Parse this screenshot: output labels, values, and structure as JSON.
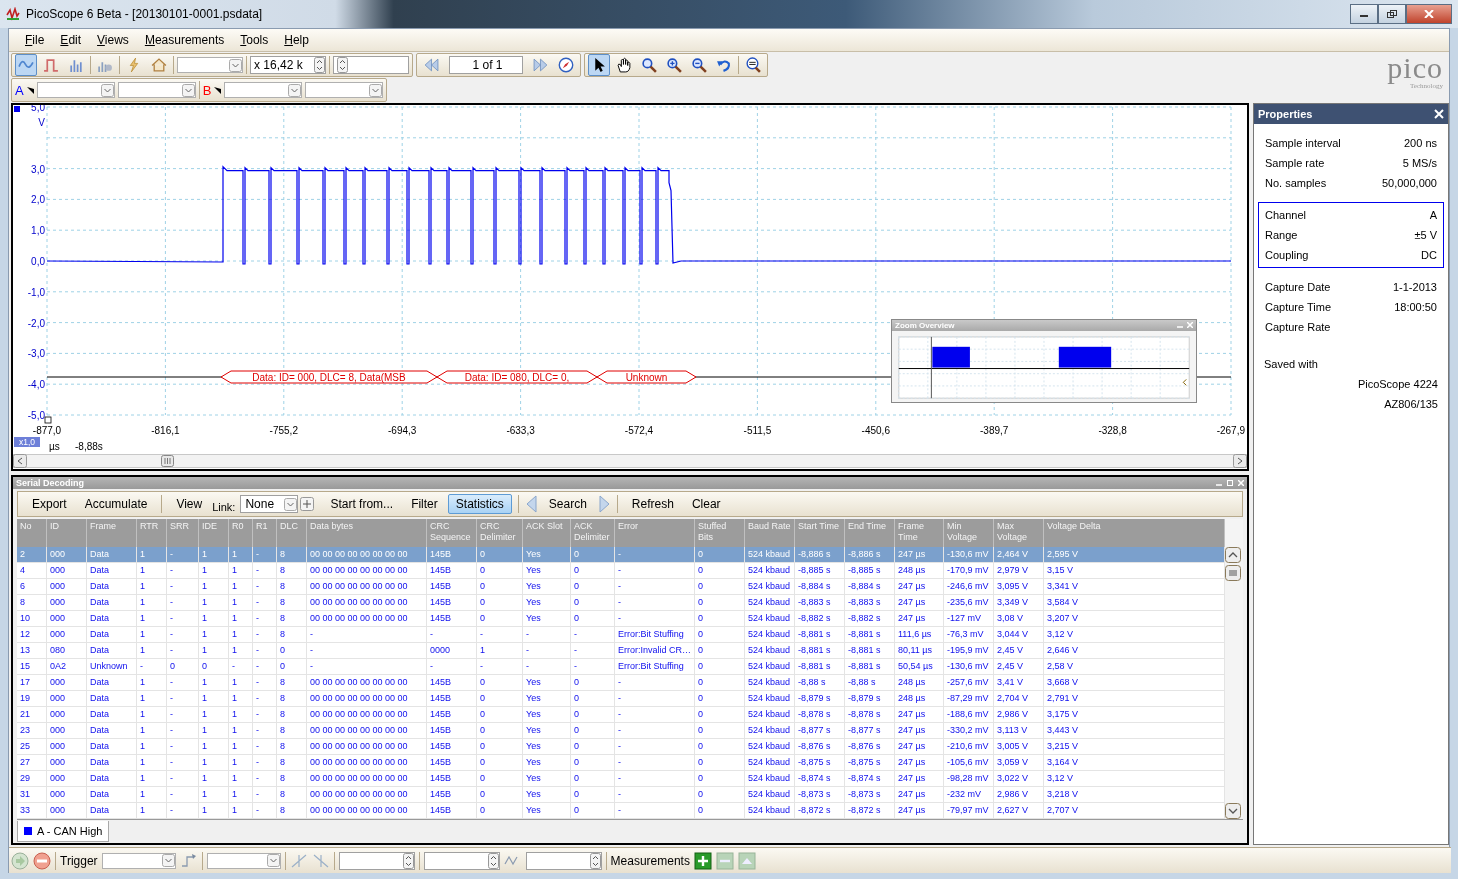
{
  "window": {
    "title": "PicoScope 6 Beta - [20130101-0001.psdata]"
  },
  "menu": [
    "File",
    "Edit",
    "Views",
    "Measurements",
    "Tools",
    "Help"
  ],
  "toolbar": {
    "modes": [
      {
        "kind": "scope",
        "selected": true
      },
      {
        "kind": "persistence",
        "selected": false
      },
      {
        "kind": "spectrum",
        "selected": false
      }
    ],
    "zoom_factor": "x 16,42 k",
    "buffer": "1  of 1",
    "tools": [
      {
        "kind": "pointer",
        "selected": true
      },
      {
        "kind": "hand",
        "selected": false
      },
      {
        "kind": "zoom",
        "selected": false
      },
      {
        "kind": "zoom-in",
        "selected": false
      },
      {
        "kind": "zoom-out",
        "selected": false
      },
      {
        "kind": "undo",
        "selected": false
      },
      {
        "kind": "zoom-100",
        "selected": false
      }
    ]
  },
  "channels": [
    {
      "label": "A",
      "color": "#0000ff"
    },
    {
      "label": "B",
      "color": "#ff0000"
    }
  ],
  "logo": {
    "name": "pico",
    "tagline": "Technology"
  },
  "scope": {
    "y_unit": "V",
    "y_labels": [
      "5,0",
      "3,0",
      "2,0",
      "1,0",
      "0,0",
      "-1,0",
      "-2,0",
      "-3,0",
      "-4,0",
      "-5,0"
    ],
    "x_labels": [
      "-877,0",
      "-816,1",
      "-755,2",
      "-694,3",
      "-633,3",
      "-572,4",
      "-511,5",
      "-450,6",
      "-389,7",
      "-328,8",
      "-267,9"
    ],
    "x_unit": "µs",
    "zoom_badge": "x1,0",
    "time_offset": "-8,88s",
    "decodes": [
      {
        "text": "Data: ID= 000, DLC= 8, Data(MSB"
      },
      {
        "text": "Data: ID= 080, DLC= 0,"
      },
      {
        "text": "Unknown"
      }
    ],
    "zoom_overview": {
      "title": "Zoom Overview"
    }
  },
  "properties": {
    "title": "Properties",
    "groups": [
      {
        "boxed": false,
        "rows": [
          {
            "label": "Sample interval",
            "value": "200 ns"
          },
          {
            "label": "Sample rate",
            "value": "5 MS/s"
          },
          {
            "label": "No. samples",
            "value": "50,000,000"
          }
        ]
      },
      {
        "boxed": true,
        "rows": [
          {
            "label": "Channel",
            "value": "A"
          },
          {
            "label": "Range",
            "value": "±5 V"
          },
          {
            "label": "Coupling",
            "value": "DC"
          }
        ]
      },
      {
        "boxed": false,
        "rows": [
          {
            "label": "Capture Date",
            "value": "1-1-2013"
          },
          {
            "label": "Capture Time",
            "value": "18:00:50"
          },
          {
            "label": "Capture Rate"
          }
        ]
      }
    ],
    "saved_with": {
      "label": "Saved with",
      "values": [
        "PicoScope 4224",
        "AZ806/135"
      ]
    }
  },
  "serial": {
    "title": "Serial Decoding",
    "toolbar": [
      {
        "kind": "button",
        "label": "Export",
        "on": false
      },
      {
        "kind": "button",
        "label": "Accumulate",
        "on": false
      },
      {
        "kind": "separator"
      },
      {
        "kind": "button",
        "label": "View",
        "on": false
      },
      {
        "kind": "link",
        "label": "Link:",
        "value": "None"
      },
      {
        "kind": "button",
        "label": "Start from...",
        "on": false
      },
      {
        "kind": "button",
        "label": "Filter",
        "on": false
      },
      {
        "kind": "button",
        "label": "Statistics",
        "on": true
      },
      {
        "kind": "separator"
      },
      {
        "kind": "prev"
      },
      {
        "kind": "button",
        "label": "Search",
        "on": false
      },
      {
        "kind": "next"
      },
      {
        "kind": "separator"
      },
      {
        "kind": "button",
        "label": "Refresh",
        "on": false
      },
      {
        "kind": "button",
        "label": "Clear",
        "on": false
      }
    ],
    "columns": [
      "No",
      "ID",
      "Frame",
      "RTR",
      "SRR",
      "IDE",
      "R0",
      "R1",
      "DLC",
      "Data bytes",
      "CRC Sequence",
      "CRC Delimiter",
      "ACK Slot",
      "ACK Delimiter",
      "Error",
      "Stuffed Bits",
      "Baud Rate",
      "Start Time",
      "End Time",
      "Frame Time",
      "Min Voltage",
      "Max Voltage",
      "Voltage Delta"
    ],
    "rows": [
      {
        "selected": true,
        "cells": [
          "2",
          "000",
          "Data",
          "1",
          "-",
          "1",
          "1",
          "-",
          "8",
          "00 00 00 00 00 00 00 00",
          "145B",
          "0",
          "Yes",
          "0",
          "-",
          "0",
          "524 kbaud",
          "-8,886 s",
          "-8,886 s",
          "247 µs",
          "-130,6 mV",
          "2,464 V",
          "2,595 V"
        ]
      },
      {
        "selected": false,
        "cells": [
          "4",
          "000",
          "Data",
          "1",
          "-",
          "1",
          "1",
          "-",
          "8",
          "00 00 00 00 00 00 00 00",
          "145B",
          "0",
          "Yes",
          "0",
          "-",
          "0",
          "524 kbaud",
          "-8,885 s",
          "-8,885 s",
          "248 µs",
          "-170,9 mV",
          "2,979 V",
          "3,15 V"
        ]
      },
      {
        "selected": false,
        "cells": [
          "6",
          "000",
          "Data",
          "1",
          "-",
          "1",
          "1",
          "-",
          "8",
          "00 00 00 00 00 00 00 00",
          "145B",
          "0",
          "Yes",
          "0",
          "-",
          "0",
          "524 kbaud",
          "-8,884 s",
          "-8,884 s",
          "247 µs",
          "-246,6 mV",
          "3,095 V",
          "3,341 V"
        ]
      },
      {
        "selected": false,
        "cells": [
          "8",
          "000",
          "Data",
          "1",
          "-",
          "1",
          "1",
          "-",
          "8",
          "00 00 00 00 00 00 00 00",
          "145B",
          "0",
          "Yes",
          "0",
          "-",
          "0",
          "524 kbaud",
          "-8,883 s",
          "-8,883 s",
          "247 µs",
          "-235,6 mV",
          "3,349 V",
          "3,584 V"
        ]
      },
      {
        "selected": false,
        "cells": [
          "10",
          "000",
          "Data",
          "1",
          "-",
          "1",
          "1",
          "-",
          "8",
          "00 00 00 00 00 00 00 00",
          "145B",
          "0",
          "Yes",
          "0",
          "-",
          "0",
          "524 kbaud",
          "-8,882 s",
          "-8,882 s",
          "247 µs",
          "-127 mV",
          "3,08 V",
          "3,207 V"
        ]
      },
      {
        "selected": false,
        "cells": [
          "12",
          "000",
          "Data",
          "1",
          "-",
          "1",
          "1",
          "-",
          "8",
          "-",
          "-",
          "-",
          "-",
          "-",
          "Error:Bit Stuffing",
          "0",
          "524 kbaud",
          "-8,881 s",
          "-8,881 s",
          "111,6 µs",
          "-76,3 mV",
          "3,044 V",
          "3,12 V"
        ]
      },
      {
        "selected": false,
        "cells": [
          "13",
          "080",
          "Data",
          "1",
          "-",
          "1",
          "1",
          "-",
          "0",
          "-",
          "0000",
          "1",
          "-",
          "-",
          "Error:Invalid CR…",
          "0",
          "524 kbaud",
          "-8,881 s",
          "-8,881 s",
          "80,11 µs",
          "-195,9 mV",
          "2,45 V",
          "2,646 V"
        ]
      },
      {
        "selected": false,
        "cells": [
          "15",
          "0A2",
          "Unknown",
          "-",
          "0",
          "0",
          "-",
          "-",
          "0",
          "-",
          "-",
          "-",
          "-",
          "-",
          "Error:Bit Stuffing",
          "0",
          "524 kbaud",
          "-8,881 s",
          "-8,881 s",
          "50,54 µs",
          "-130,6 mV",
          "2,45 V",
          "2,58 V"
        ]
      },
      {
        "selected": false,
        "cells": [
          "17",
          "000",
          "Data",
          "1",
          "-",
          "1",
          "1",
          "-",
          "8",
          "00 00 00 00 00 00 00 00",
          "145B",
          "0",
          "Yes",
          "0",
          "-",
          "0",
          "524 kbaud",
          "-8,88 s",
          "-8,88 s",
          "248 µs",
          "-257,6 mV",
          "3,41 V",
          "3,668 V"
        ]
      },
      {
        "selected": false,
        "cells": [
          "19",
          "000",
          "Data",
          "1",
          "-",
          "1",
          "1",
          "-",
          "8",
          "00 00 00 00 00 00 00 00",
          "145B",
          "0",
          "Yes",
          "0",
          "-",
          "0",
          "524 kbaud",
          "-8,879 s",
          "-8,879 s",
          "248 µs",
          "-87,29 mV",
          "2,704 V",
          "2,791 V"
        ]
      },
      {
        "selected": false,
        "cells": [
          "21",
          "000",
          "Data",
          "1",
          "-",
          "1",
          "1",
          "-",
          "8",
          "00 00 00 00 00 00 00 00",
          "145B",
          "0",
          "Yes",
          "0",
          "-",
          "0",
          "524 kbaud",
          "-8,878 s",
          "-8,878 s",
          "247 µs",
          "-188,6 mV",
          "2,986 V",
          "3,175 V"
        ]
      },
      {
        "selected": false,
        "cells": [
          "23",
          "000",
          "Data",
          "1",
          "-",
          "1",
          "1",
          "-",
          "8",
          "00 00 00 00 00 00 00 00",
          "145B",
          "0",
          "Yes",
          "0",
          "-",
          "0",
          "524 kbaud",
          "-8,877 s",
          "-8,877 s",
          "247 µs",
          "-330,2 mV",
          "3,113 V",
          "3,443 V"
        ]
      },
      {
        "selected": false,
        "cells": [
          "25",
          "000",
          "Data",
          "1",
          "-",
          "1",
          "1",
          "-",
          "8",
          "00 00 00 00 00 00 00 00",
          "145B",
          "0",
          "Yes",
          "0",
          "-",
          "0",
          "524 kbaud",
          "-8,876 s",
          "-8,876 s",
          "247 µs",
          "-210,6 mV",
          "3,005 V",
          "3,215 V"
        ]
      },
      {
        "selected": false,
        "cells": [
          "27",
          "000",
          "Data",
          "1",
          "-",
          "1",
          "1",
          "-",
          "8",
          "00 00 00 00 00 00 00 00",
          "145B",
          "0",
          "Yes",
          "0",
          "-",
          "0",
          "524 kbaud",
          "-8,875 s",
          "-8,875 s",
          "247 µs",
          "-105,6 mV",
          "3,059 V",
          "3,164 V"
        ]
      },
      {
        "selected": false,
        "cells": [
          "29",
          "000",
          "Data",
          "1",
          "-",
          "1",
          "1",
          "-",
          "8",
          "00 00 00 00 00 00 00 00",
          "145B",
          "0",
          "Yes",
          "0",
          "-",
          "0",
          "524 kbaud",
          "-8,874 s",
          "-8,874 s",
          "247 µs",
          "-98,28 mV",
          "3,022 V",
          "3,12 V"
        ]
      },
      {
        "selected": false,
        "cells": [
          "31",
          "000",
          "Data",
          "1",
          "-",
          "1",
          "1",
          "-",
          "8",
          "00 00 00 00 00 00 00 00",
          "145B",
          "0",
          "Yes",
          "0",
          "-",
          "0",
          "524 kbaud",
          "-8,873 s",
          "-8,873 s",
          "247 µs",
          "-232 mV",
          "2,986 V",
          "3,218 V"
        ]
      },
      {
        "selected": false,
        "cells": [
          "33",
          "000",
          "Data",
          "1",
          "-",
          "1",
          "1",
          "-",
          "8",
          "00 00 00 00 00 00 00 00",
          "145B",
          "0",
          "Yes",
          "0",
          "-",
          "0",
          "524 kbaud",
          "-8,872 s",
          "-8,872 s",
          "247 µs",
          "-79,97 mV",
          "2,627 V",
          "2,707 V"
        ]
      }
    ],
    "tabs": [
      {
        "label": "A - CAN High",
        "color": "#0000ff",
        "selected": true
      }
    ]
  },
  "bottom": {
    "trigger_label": "Trigger",
    "measurements_label": "Measurements"
  }
}
